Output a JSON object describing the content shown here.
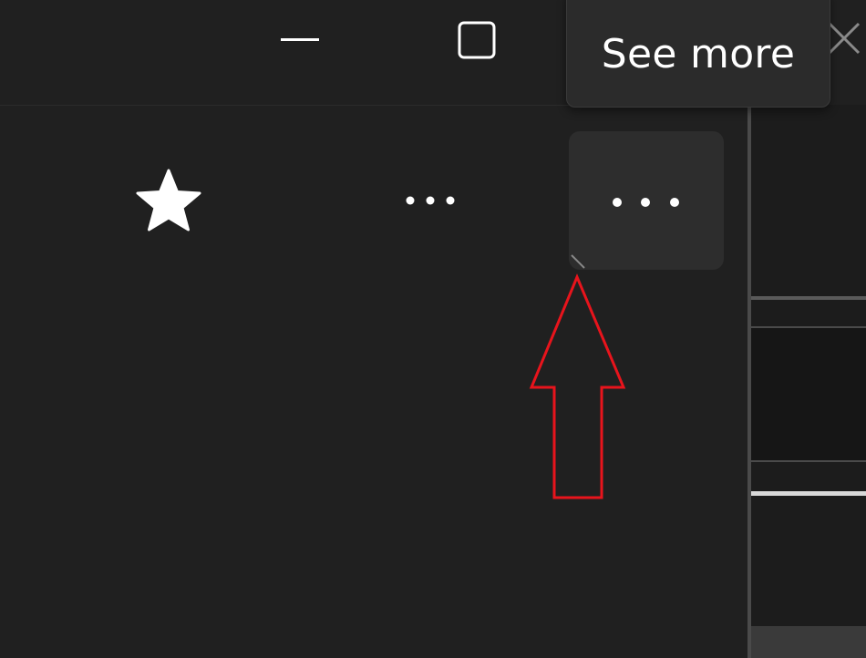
{
  "tooltip": {
    "text": "See more"
  },
  "icons": {
    "minimize": "minimize-icon",
    "maximize": "maximize-icon",
    "close": "close-icon",
    "favorite": "star-icon",
    "more": "more-horizontal-icon",
    "annotation": "arrow-up-icon"
  },
  "colors": {
    "background": "#202020",
    "button_hover": "#2d2d2d",
    "tooltip_bg": "#2b2b2b",
    "icon": "#ffffff",
    "annotation_arrow": "#e8141c"
  }
}
